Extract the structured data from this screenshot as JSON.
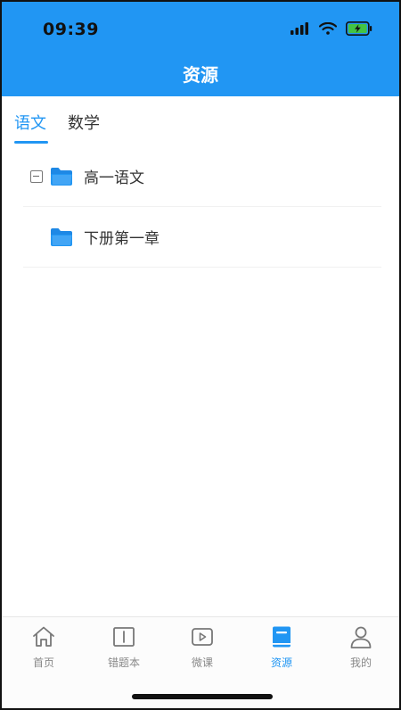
{
  "status": {
    "time": "09:39"
  },
  "nav": {
    "title": "资源"
  },
  "tabs": [
    {
      "label": "语文",
      "active": true
    },
    {
      "label": "数学",
      "active": false
    }
  ],
  "tree": [
    {
      "label": "高一语文",
      "expanded": true,
      "icon": "folder-icon"
    },
    {
      "label": "下册第一章",
      "icon": "folder-icon"
    }
  ],
  "tabbar": [
    {
      "label": "首页",
      "icon": "home-icon",
      "active": false
    },
    {
      "label": "错题本",
      "icon": "book-open-icon",
      "active": false
    },
    {
      "label": "微课",
      "icon": "video-play-icon",
      "active": false
    },
    {
      "label": "资源",
      "icon": "book-icon",
      "active": true
    },
    {
      "label": "我的",
      "icon": "user-icon",
      "active": false
    }
  ],
  "colors": {
    "accent": "#2196f3",
    "battery": "#43c443"
  }
}
